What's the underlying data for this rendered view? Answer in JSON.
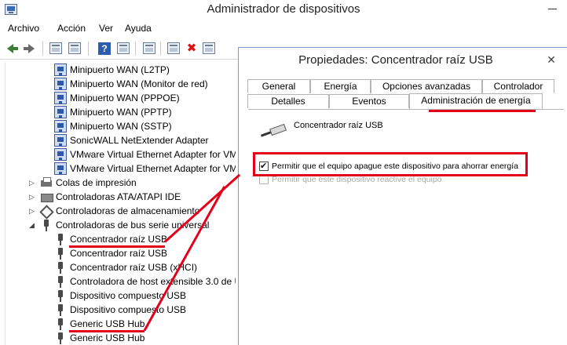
{
  "window": {
    "title": "Administrador de dispositivos"
  },
  "menu": [
    "Archivo",
    "Acción",
    "Ver",
    "Ayuda"
  ],
  "toolbar": {
    "icons": [
      "back-icon",
      "forward-icon",
      "properties-icon",
      "device-list-icon",
      "help-icon",
      "view-icon",
      "monitor-icon",
      "update-driver-icon",
      "uninstall-icon",
      "scan-hardware-icon"
    ]
  },
  "tree": {
    "items": [
      {
        "label": "Minipuerto WAN (L2TP)",
        "icon": "network-adapter-icon",
        "level": 2
      },
      {
        "label": "Minipuerto WAN (Monitor de red)",
        "icon": "network-adapter-icon",
        "level": 2
      },
      {
        "label": "Minipuerto WAN (PPPOE)",
        "icon": "network-adapter-icon",
        "level": 2
      },
      {
        "label": "Minipuerto WAN (PPTP)",
        "icon": "network-adapter-icon",
        "level": 2
      },
      {
        "label": "Minipuerto WAN (SSTP)",
        "icon": "network-adapter-icon",
        "level": 2
      },
      {
        "label": "SonicWALL NetExtender Adapter",
        "icon": "network-adapter-icon",
        "level": 2
      },
      {
        "label": "VMware Virtual Ethernet Adapter for VM",
        "icon": "network-adapter-icon",
        "level": 2
      },
      {
        "label": "VMware Virtual Ethernet Adapter for VM",
        "icon": "network-adapter-icon",
        "level": 2
      },
      {
        "label": "Colas de impresión",
        "icon": "printer-icon",
        "level": 1,
        "expander": "▷"
      },
      {
        "label": "Controladoras ATA/ATAPI IDE",
        "icon": "disk-controller-icon",
        "level": 1,
        "expander": "▷"
      },
      {
        "label": "Controladoras de almacenamiento",
        "icon": "storage-icon",
        "level": 1,
        "expander": "▷"
      },
      {
        "label": "Controladoras de bus serie universal",
        "icon": "usb-icon",
        "level": 1,
        "expander": "◢"
      },
      {
        "label": "Concentrador raíz USB",
        "icon": "usb-icon",
        "level": 2
      },
      {
        "label": "Concentrador raíz USB",
        "icon": "usb-icon",
        "level": 2
      },
      {
        "label": "Concentrador raíz USB (xHCI)",
        "icon": "usb-icon",
        "level": 2
      },
      {
        "label": "Controladora de host extensible 3.0 de U",
        "icon": "usb-icon",
        "level": 2
      },
      {
        "label": "Dispositivo compuesto USB",
        "icon": "usb-icon",
        "level": 2
      },
      {
        "label": "Dispositivo compuesto USB",
        "icon": "usb-icon",
        "level": 2
      },
      {
        "label": "Generic USB Hub",
        "icon": "usb-icon",
        "level": 2
      },
      {
        "label": "Generic USB Hub",
        "icon": "usb-icon",
        "level": 2
      }
    ]
  },
  "dialog": {
    "title": "Propiedades: Concentrador raíz USB",
    "tabs_row1": [
      "General",
      "Energía",
      "Opciones avanzadas",
      "Controlador"
    ],
    "tabs_row2": [
      "Detalles",
      "Eventos",
      "Administración de energía"
    ],
    "selected_tab": "Administración de energía",
    "device_name": "Concentrador raíz USB",
    "options": [
      {
        "label": "Permitir que el equipo apague este dispositivo para ahorrar energía",
        "checked": true,
        "enabled": true
      },
      {
        "label": "Permitir que este dispositivo reactive el equipo",
        "checked": false,
        "enabled": false
      }
    ]
  },
  "annotation_color": "#e3001b"
}
